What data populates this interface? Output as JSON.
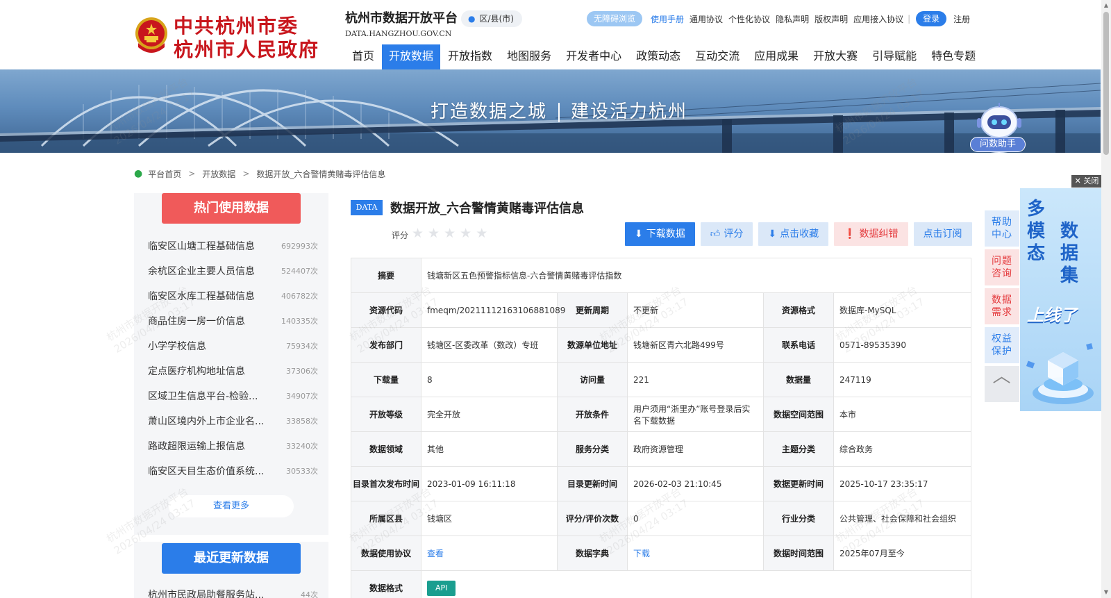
{
  "header": {
    "gov_line1": "中共杭州市委",
    "gov_line2": "杭州市人民政府",
    "platform_title": "杭州市数据开放平台",
    "platform_domain": "DATA.HANGZHOU.GOV.CN",
    "district_label": "区/县(市)",
    "barrier_free": "无障碍浏览",
    "links": [
      "使用手册",
      "通用协议",
      "个性化协议",
      "隐私声明",
      "版权声明",
      "应用接入协议"
    ],
    "login": "登录",
    "register": "注册",
    "nav": [
      "首页",
      "开放数据",
      "开放指数",
      "地图服务",
      "开发者中心",
      "政策动态",
      "互动交流",
      "应用成果",
      "开放大赛",
      "引导赋能",
      "特色专题"
    ],
    "nav_active_index": 1
  },
  "banner": {
    "slogan_left": "打造数据之城",
    "slogan_right": "建设活力杭州",
    "assistant_label": "问数助手"
  },
  "breadcrumb": [
    "平台首页",
    "开放数据",
    "数据开放_六合警情黄赌毒评估信息"
  ],
  "sidebar": {
    "hot_title": "热门使用数据",
    "hot_items": [
      {
        "name": "临安区山塘工程基础信息",
        "count": "692993次"
      },
      {
        "name": "余杭区企业主要人员信息",
        "count": "524407次"
      },
      {
        "name": "临安区水库工程基础信息",
        "count": "406782次"
      },
      {
        "name": "商品住房一房一价信息",
        "count": "140335次"
      },
      {
        "name": "小学学校信息",
        "count": "75934次"
      },
      {
        "name": "定点医疗机构地址信息",
        "count": "37306次"
      },
      {
        "name": "区域卫生信息平台-检验...",
        "count": "34907次"
      },
      {
        "name": "萧山区境内外上市企业名...",
        "count": "33858次"
      },
      {
        "name": "路政超限运输上报信息",
        "count": "33240次"
      },
      {
        "name": "临安区天目生态价值系统...",
        "count": "30533次"
      }
    ],
    "more_label": "查看更多",
    "recent_title": "最近更新数据",
    "recent_items": [
      {
        "name": "杭州市民政局助餐服务站...",
        "count": "44次"
      }
    ]
  },
  "dataset": {
    "badge": "DATA",
    "title": "数据开放_六合警情黄赌毒评估信息",
    "rating_label": "评分",
    "star_count": 5,
    "actions": {
      "download": "下载数据",
      "rate": "评分",
      "favorite": "点击收藏",
      "report_error": "数据纠错",
      "subscribe": "点击订阅"
    }
  },
  "info": {
    "summary_label": "摘要",
    "summary": "钱塘新区五色预警指标信息-六合警情黄赌毒评估指数",
    "rows": [
      [
        {
          "label": "资源代码",
          "value": "fmeqm/20211112163106881089"
        },
        {
          "label": "更新周期",
          "value": "不更新"
        },
        {
          "label": "资源格式",
          "value": "数据库-MySQL"
        }
      ],
      [
        {
          "label": "发布部门",
          "value": "钱塘区-区委改革（数改）专班"
        },
        {
          "label": "数源单位地址",
          "value": "钱塘新区青六北路499号"
        },
        {
          "label": "联系电话",
          "value": "0571-89535390"
        }
      ],
      [
        {
          "label": "下载量",
          "value": "8"
        },
        {
          "label": "访问量",
          "value": "221"
        },
        {
          "label": "数据量",
          "value": "247119"
        }
      ],
      [
        {
          "label": "开放等级",
          "value": "完全开放"
        },
        {
          "label": "开放条件",
          "value": "用户须用“浙里办”账号登录后实名下载数据"
        },
        {
          "label": "数据空间范围",
          "value": "本市"
        }
      ],
      [
        {
          "label": "数据领域",
          "value": "其他"
        },
        {
          "label": "服务分类",
          "value": "政府资源管理"
        },
        {
          "label": "主题分类",
          "value": "综合政务"
        }
      ],
      [
        {
          "label": "目录首次发布时间",
          "value": "2023-01-09 16:11:18"
        },
        {
          "label": "目录更新时间",
          "value": "2026-02-03 21:10:45"
        },
        {
          "label": "数据更新时间",
          "value": "2025-10-17 23:35:17"
        }
      ],
      [
        {
          "label": "所属区县",
          "value": "钱塘区"
        },
        {
          "label": "评分/评价次数",
          "value": "0"
        },
        {
          "label": "行业分类",
          "value": "公共管理、社会保障和社会组织"
        }
      ],
      [
        {
          "label": "数据使用协议",
          "value": "查看"
        },
        {
          "label": "数据字典",
          "value": "下载"
        },
        {
          "label": "数据时间范围",
          "value": "2025年07月至今"
        }
      ]
    ],
    "format_label": "数据格式",
    "format_tag": "API"
  },
  "side_float": {
    "help": [
      "帮助",
      "中心"
    ],
    "question": [
      "问题",
      "咨询"
    ],
    "demand": [
      "数据",
      "需求"
    ],
    "rights": [
      "权益",
      "保护"
    ],
    "top": "︿"
  },
  "ad": {
    "close": "✕ 关闭",
    "line1": "多模态",
    "line2": "数据集",
    "line3": "上线了"
  },
  "watermark": {
    "line1": "杭州市数据开放平台",
    "line2": "2026/04/24 03:17"
  },
  "colors": {
    "primary": "#2b7de9",
    "hot": "#f05a5a",
    "danger": "#e4393c",
    "gov_red": "#c8161d",
    "api_tag": "#1a9e8f"
  }
}
